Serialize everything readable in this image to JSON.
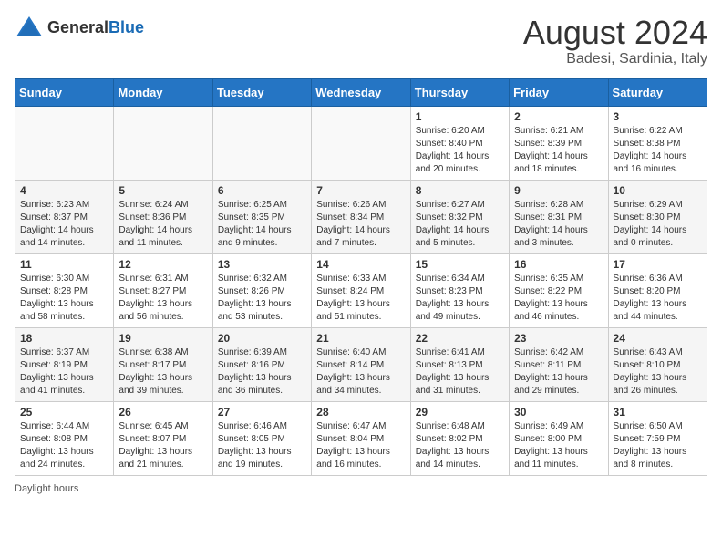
{
  "header": {
    "logo_general": "General",
    "logo_blue": "Blue",
    "month_year": "August 2024",
    "location": "Badesi, Sardinia, Italy"
  },
  "footer": {
    "label": "Daylight hours"
  },
  "days_of_week": [
    "Sunday",
    "Monday",
    "Tuesday",
    "Wednesday",
    "Thursday",
    "Friday",
    "Saturday"
  ],
  "weeks": [
    [
      {
        "day": "",
        "info": ""
      },
      {
        "day": "",
        "info": ""
      },
      {
        "day": "",
        "info": ""
      },
      {
        "day": "",
        "info": ""
      },
      {
        "day": "1",
        "info": "Sunrise: 6:20 AM\nSunset: 8:40 PM\nDaylight: 14 hours and 20 minutes."
      },
      {
        "day": "2",
        "info": "Sunrise: 6:21 AM\nSunset: 8:39 PM\nDaylight: 14 hours and 18 minutes."
      },
      {
        "day": "3",
        "info": "Sunrise: 6:22 AM\nSunset: 8:38 PM\nDaylight: 14 hours and 16 minutes."
      }
    ],
    [
      {
        "day": "4",
        "info": "Sunrise: 6:23 AM\nSunset: 8:37 PM\nDaylight: 14 hours and 14 minutes."
      },
      {
        "day": "5",
        "info": "Sunrise: 6:24 AM\nSunset: 8:36 PM\nDaylight: 14 hours and 11 minutes."
      },
      {
        "day": "6",
        "info": "Sunrise: 6:25 AM\nSunset: 8:35 PM\nDaylight: 14 hours and 9 minutes."
      },
      {
        "day": "7",
        "info": "Sunrise: 6:26 AM\nSunset: 8:34 PM\nDaylight: 14 hours and 7 minutes."
      },
      {
        "day": "8",
        "info": "Sunrise: 6:27 AM\nSunset: 8:32 PM\nDaylight: 14 hours and 5 minutes."
      },
      {
        "day": "9",
        "info": "Sunrise: 6:28 AM\nSunset: 8:31 PM\nDaylight: 14 hours and 3 minutes."
      },
      {
        "day": "10",
        "info": "Sunrise: 6:29 AM\nSunset: 8:30 PM\nDaylight: 14 hours and 0 minutes."
      }
    ],
    [
      {
        "day": "11",
        "info": "Sunrise: 6:30 AM\nSunset: 8:28 PM\nDaylight: 13 hours and 58 minutes."
      },
      {
        "day": "12",
        "info": "Sunrise: 6:31 AM\nSunset: 8:27 PM\nDaylight: 13 hours and 56 minutes."
      },
      {
        "day": "13",
        "info": "Sunrise: 6:32 AM\nSunset: 8:26 PM\nDaylight: 13 hours and 53 minutes."
      },
      {
        "day": "14",
        "info": "Sunrise: 6:33 AM\nSunset: 8:24 PM\nDaylight: 13 hours and 51 minutes."
      },
      {
        "day": "15",
        "info": "Sunrise: 6:34 AM\nSunset: 8:23 PM\nDaylight: 13 hours and 49 minutes."
      },
      {
        "day": "16",
        "info": "Sunrise: 6:35 AM\nSunset: 8:22 PM\nDaylight: 13 hours and 46 minutes."
      },
      {
        "day": "17",
        "info": "Sunrise: 6:36 AM\nSunset: 8:20 PM\nDaylight: 13 hours and 44 minutes."
      }
    ],
    [
      {
        "day": "18",
        "info": "Sunrise: 6:37 AM\nSunset: 8:19 PM\nDaylight: 13 hours and 41 minutes."
      },
      {
        "day": "19",
        "info": "Sunrise: 6:38 AM\nSunset: 8:17 PM\nDaylight: 13 hours and 39 minutes."
      },
      {
        "day": "20",
        "info": "Sunrise: 6:39 AM\nSunset: 8:16 PM\nDaylight: 13 hours and 36 minutes."
      },
      {
        "day": "21",
        "info": "Sunrise: 6:40 AM\nSunset: 8:14 PM\nDaylight: 13 hours and 34 minutes."
      },
      {
        "day": "22",
        "info": "Sunrise: 6:41 AM\nSunset: 8:13 PM\nDaylight: 13 hours and 31 minutes."
      },
      {
        "day": "23",
        "info": "Sunrise: 6:42 AM\nSunset: 8:11 PM\nDaylight: 13 hours and 29 minutes."
      },
      {
        "day": "24",
        "info": "Sunrise: 6:43 AM\nSunset: 8:10 PM\nDaylight: 13 hours and 26 minutes."
      }
    ],
    [
      {
        "day": "25",
        "info": "Sunrise: 6:44 AM\nSunset: 8:08 PM\nDaylight: 13 hours and 24 minutes."
      },
      {
        "day": "26",
        "info": "Sunrise: 6:45 AM\nSunset: 8:07 PM\nDaylight: 13 hours and 21 minutes."
      },
      {
        "day": "27",
        "info": "Sunrise: 6:46 AM\nSunset: 8:05 PM\nDaylight: 13 hours and 19 minutes."
      },
      {
        "day": "28",
        "info": "Sunrise: 6:47 AM\nSunset: 8:04 PM\nDaylight: 13 hours and 16 minutes."
      },
      {
        "day": "29",
        "info": "Sunrise: 6:48 AM\nSunset: 8:02 PM\nDaylight: 13 hours and 14 minutes."
      },
      {
        "day": "30",
        "info": "Sunrise: 6:49 AM\nSunset: 8:00 PM\nDaylight: 13 hours and 11 minutes."
      },
      {
        "day": "31",
        "info": "Sunrise: 6:50 AM\nSunset: 7:59 PM\nDaylight: 13 hours and 8 minutes."
      }
    ]
  ]
}
